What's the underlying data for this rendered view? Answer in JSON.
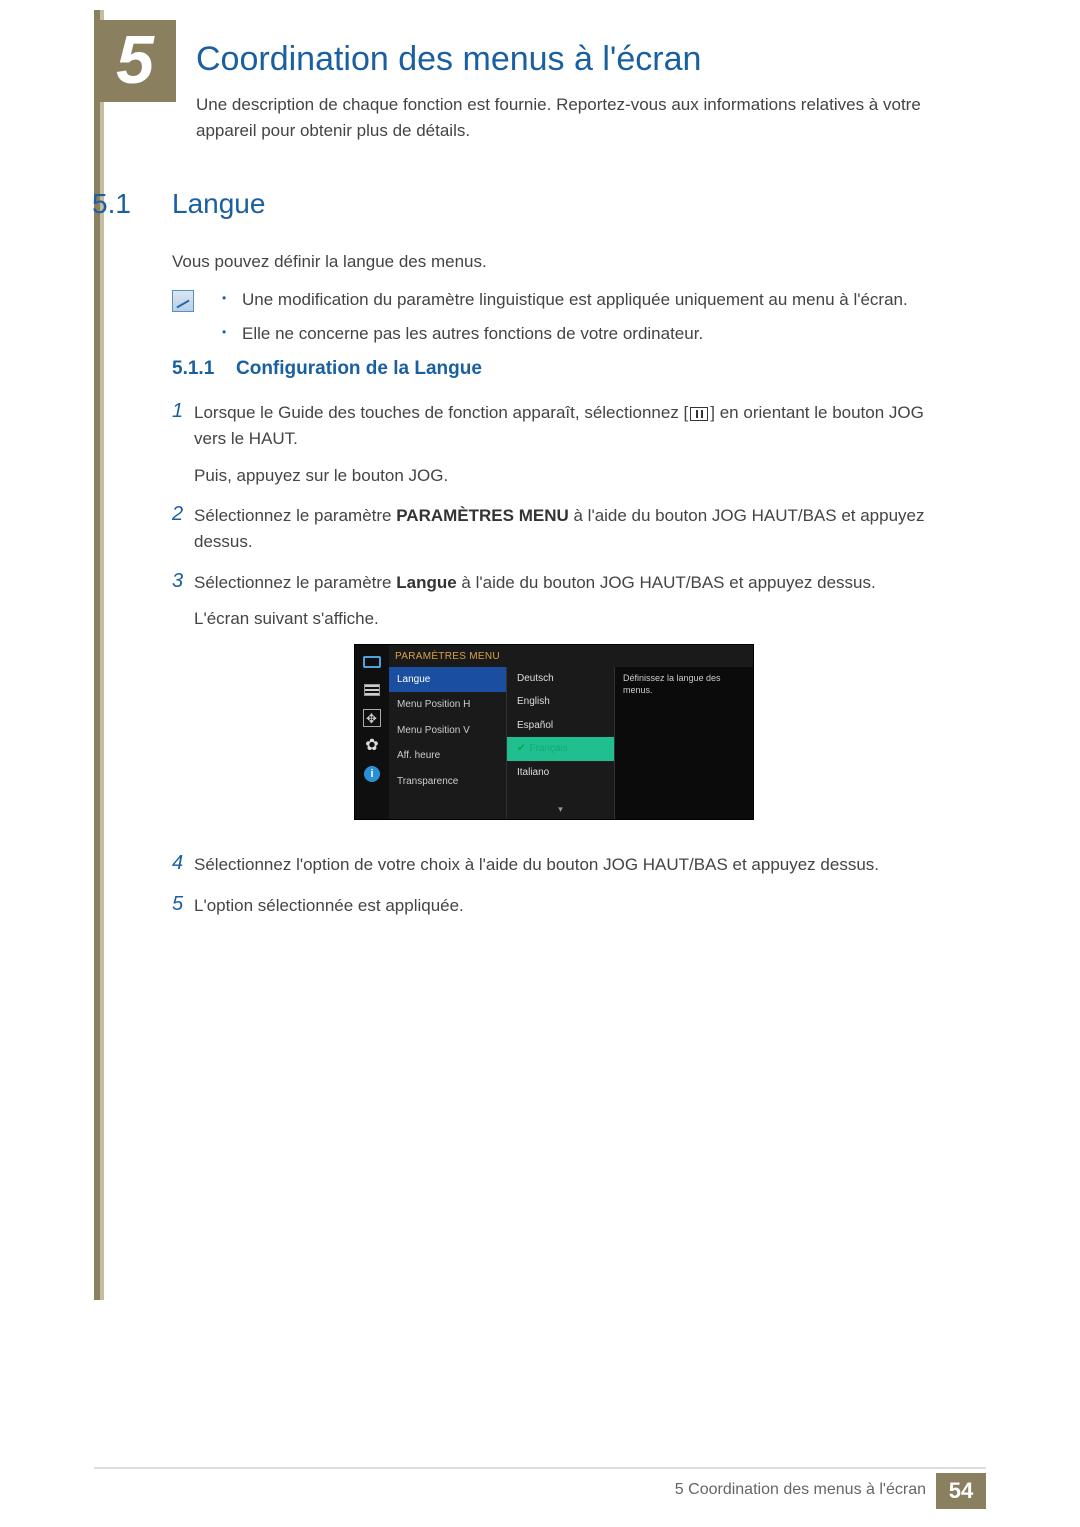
{
  "chapter": {
    "number": "5",
    "title": "Coordination des menus à l'écran",
    "description": "Une description de chaque fonction est fournie. Reportez-vous aux informations relatives à votre appareil pour obtenir plus de détails."
  },
  "section": {
    "number": "5.1",
    "title": "Langue",
    "intro": "Vous pouvez définir la langue des menus.",
    "notes": [
      "Une modification du paramètre linguistique est appliquée uniquement au menu à l'écran.",
      "Elle ne concerne pas les autres fonctions de votre ordinateur."
    ]
  },
  "subsection": {
    "number": "5.1.1",
    "title": "Configuration de la Langue"
  },
  "steps": {
    "s1": {
      "num": "1",
      "text_a": "Lorsque le Guide des touches de fonction apparaît, sélectionnez [",
      "text_b": "] en orientant le bouton JOG vers le HAUT.",
      "text_c": "Puis, appuyez sur le bouton JOG."
    },
    "s2": {
      "num": "2",
      "text_a": "Sélectionnez le paramètre ",
      "bold": "PARAMÈTRES MENU",
      "text_b": " à l'aide du bouton JOG HAUT/BAS et appuyez dessus."
    },
    "s3": {
      "num": "3",
      "text_a": "Sélectionnez le paramètre ",
      "bold": "Langue",
      "text_b": " à l'aide du bouton JOG HAUT/BAS et appuyez dessus.",
      "text_c": "L'écran suivant s'affiche."
    },
    "s4": {
      "num": "4",
      "text": "Sélectionnez l'option de votre choix à l'aide du bouton JOG HAUT/BAS et appuyez dessus."
    },
    "s5": {
      "num": "5",
      "text": "L'option sélectionnée est appliquée."
    }
  },
  "osd": {
    "header": "PARAMÈTRES MENU",
    "col1": {
      "item0": "Langue",
      "item1": "Menu Position H",
      "item2": "Menu Position V",
      "item3": "Aff. heure",
      "item4": "Transparence"
    },
    "col2": {
      "opt0": "Deutsch",
      "opt1": "English",
      "opt2": "Español",
      "opt3": "Français",
      "opt4": "Italiano"
    },
    "help": "Définissez la langue des menus.",
    "info_glyph": "i",
    "gear_glyph": "✿",
    "check_glyph": "✔",
    "down_glyph": "▾"
  },
  "footer": {
    "text": "5 Coordination des menus à l'écran",
    "page": "54"
  }
}
